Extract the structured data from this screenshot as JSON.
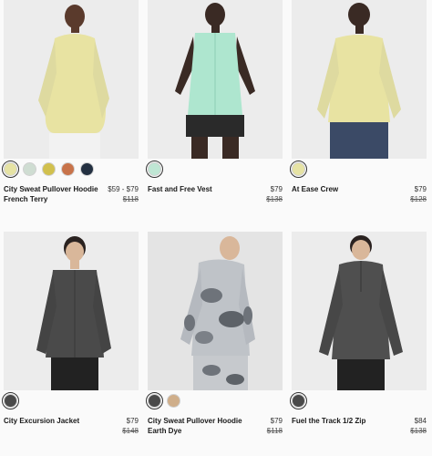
{
  "products": [
    {
      "name": "City Sweat Pullover Hoodie French Terry",
      "price": "$59 - $79",
      "original_price": "$118",
      "swatches": [
        "#e6e3a4",
        "#cfddd2",
        "#d1c04e",
        "#c8734a",
        "#233041"
      ]
    },
    {
      "name": "Fast and Free Vest",
      "price": "$79",
      "original_price": "$138",
      "swatches": [
        "#bfe6d4"
      ]
    },
    {
      "name": "At Ease Crew",
      "price": "$79",
      "original_price": "$128",
      "swatches": [
        "#e6e3a4"
      ]
    },
    {
      "name": "City Excursion Jacket",
      "price": "$79",
      "original_price": "$148",
      "swatches": [
        "#4a4a4a"
      ]
    },
    {
      "name": "City Sweat Pullover Hoodie Earth Dye",
      "price": "$79",
      "original_price": "$118",
      "swatches": [
        "#4a4a4a",
        "#cfae8a"
      ]
    },
    {
      "name": "Fuel the Track 1/2 Zip",
      "price": "$84",
      "original_price": "$138",
      "swatches": [
        "#4a4a4a"
      ]
    }
  ]
}
